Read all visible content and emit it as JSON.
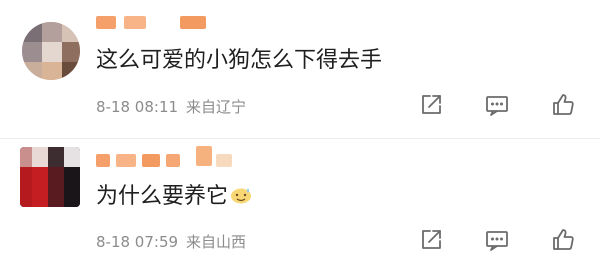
{
  "comments": [
    {
      "text": "这么可爱的小狗怎么下得去手",
      "time": "8-18 08:11",
      "location": "来自辽宁"
    },
    {
      "text": "为什么要养它",
      "time": "8-18 07:59",
      "location": "来自山西",
      "emoji": "sweat-smile-emoji"
    }
  ],
  "colors": {
    "username_accent": "#f5a06a",
    "meta_text": "#8c8c8c",
    "icon_stroke": "#6b6b6b"
  },
  "icons": [
    "share-icon",
    "comment-icon",
    "like-icon"
  ]
}
